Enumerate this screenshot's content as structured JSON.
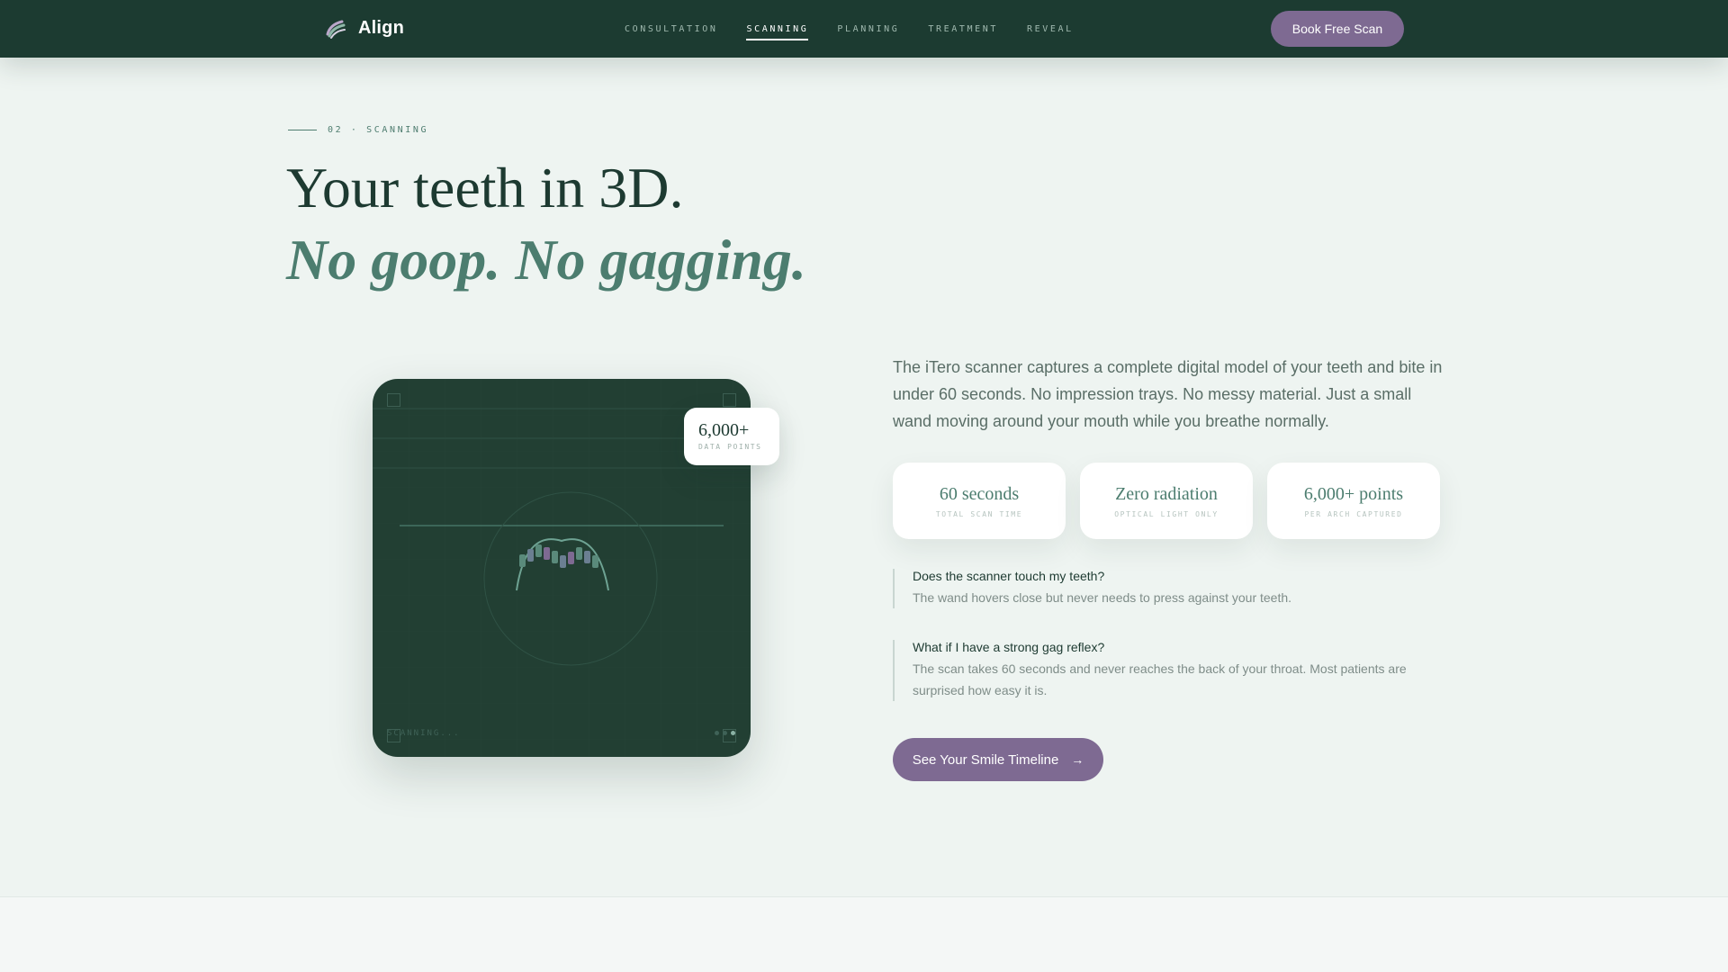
{
  "nav": {
    "brand": "Align",
    "links": [
      {
        "label": "CONSULTATION"
      },
      {
        "label": "SCANNING",
        "active": true
      },
      {
        "label": "PLANNING"
      },
      {
        "label": "TREATMENT"
      },
      {
        "label": "REVEAL"
      }
    ],
    "cta": "Book Free Scan"
  },
  "hero": {
    "eyebrow": "02 · SCANNING",
    "title": "Your teeth in 3D.",
    "subtitle": "No goop. No gagging."
  },
  "scanner": {
    "status": "SCANNING...",
    "badge_value": "6,000+",
    "badge_label": "DATA POINTS"
  },
  "content": {
    "description": "The iTero scanner captures a complete digital model of your teeth and bite in under 60 seconds. No impression trays. No messy material. Just a small wand moving around your mouth while you breathe normally.",
    "stats": [
      {
        "value": "60 seconds",
        "label": "TOTAL SCAN TIME"
      },
      {
        "value": "Zero radiation",
        "label": "OPTICAL LIGHT ONLY"
      },
      {
        "value": "6,000+ points",
        "label": "PER ARCH CAPTURED"
      }
    ],
    "faqs": [
      {
        "q": "Does the scanner touch my teeth?",
        "a": "The wand hovers close but never needs to press against your teeth."
      },
      {
        "q": "What if I have a strong gag reflex?",
        "a": "The scan takes 60 seconds and never reaches the back of your throat. Most patients are surprised how easy it is."
      }
    ],
    "cta": "See Your Smile Timeline"
  },
  "colors": {
    "nav_bg": "#1c3b31",
    "accent_purple": "#7e6a92",
    "accent_green": "#4c7d6f",
    "page_bg": "#eef4f1"
  },
  "icons": {
    "brand": "tooth-brush-logo-icon",
    "cta_arrow": "arrow-right-icon"
  }
}
